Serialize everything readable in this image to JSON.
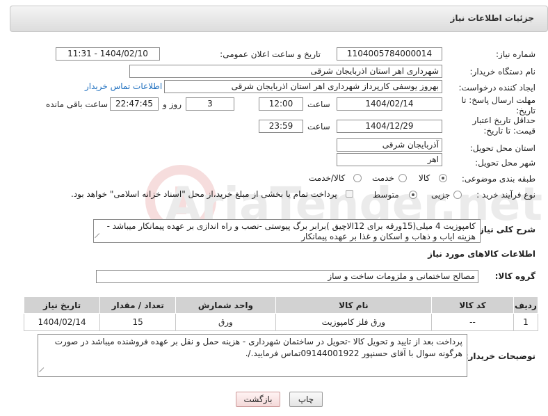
{
  "header": {
    "title": "جزئیات اطلاعات نیاز"
  },
  "labels": {
    "need_number": "شماره نیاز:",
    "announce_datetime": "تاریخ و ساعت اعلان عمومی:",
    "buyer_org": "نام دستگاه خریدار:",
    "requester": "ایجاد کننده درخواست:",
    "reply_deadline": "مهلت ارسال پاسخ: تا تاریخ:",
    "price_validity": "حداقل تاریخ اعتبار قیمت: تا تاریخ:",
    "time": "ساعت",
    "days_and": "روز و",
    "remaining": "ساعت باقی مانده",
    "delivery_province": "استان محل تحویل:",
    "delivery_city": "شهر محل تحویل:",
    "category": "طبقه بندی موضوعی:",
    "purchase_type": "نوع فرآیند خرید :",
    "general_desc": "شرح کلی نیاز:",
    "goods_info_title": "اطلاعات کالاهای مورد نیاز",
    "goods_group": "گروه کالا:",
    "buyer_notes": "توضیحات خریدار:"
  },
  "values": {
    "need_number": "1104005784000014",
    "announce_datetime": "1404/02/10 - 11:31",
    "buyer_org": "شهرداری اهر استان اذربایجان شرقی",
    "requester": "بهروز یوسفی کارپرداز شهرداری اهر استان اذربایجان شرقی",
    "buyer_contact_link": "اطلاعات تماس خریدار",
    "reply_date": "1404/02/14",
    "reply_time": "12:00",
    "reply_days": "3",
    "reply_remaining": "22:47:45",
    "validity_date": "1404/12/29",
    "validity_time": "23:59",
    "delivery_province": "آذربایجان شرقی",
    "delivery_city": "اهر",
    "general_desc": "کامپوزیت 4 میلی(15ورقه برای 12الاچیق )برابر برگ پیوستی -نصب و راه اندازی بر عهده پیمانکار میباشد - هزینه ایاب و ذهاب و اسکان و غذا بر عهده پیمانکار",
    "goods_group": "مصالح ساختمانی و ملزومات ساخت و ساز",
    "buyer_notes": "پرداخت بعد از تایید و تحویل کالا -تحویل در ساختمان شهرداری - هزینه حمل و نقل بر عهده فروشنده میباشد در صورت هرگونه سوال با آقای حسنپور 09144001922تماس فرمایید./."
  },
  "category_options": [
    {
      "label": "کالا",
      "selected": true
    },
    {
      "label": "خدمت",
      "selected": false
    },
    {
      "label": "کالا/خدمت",
      "selected": false
    }
  ],
  "purchase_options": [
    {
      "label": "جزیی",
      "selected": false
    },
    {
      "label": "متوسط",
      "selected": true
    }
  ],
  "purchase_note": "پرداخت تمام یا بخشی از مبلغ خرید،از محل \"اسناد خزانه اسلامی\" خواهد بود.",
  "table": {
    "headers": [
      "ردیف",
      "کد کالا",
      "نام کالا",
      "واحد شمارش",
      "تعداد / مقدار",
      "تاریخ نیاز"
    ],
    "rows": [
      [
        "1",
        "--",
        "ورق فلز کامپوزیت",
        "ورق",
        "15",
        "1404/02/14"
      ]
    ]
  },
  "buttons": {
    "print": "چاپ",
    "back": "بازگشت"
  },
  "watermark_text": "AriaTender.net",
  "colors": {
    "link": "#1e6fbf",
    "header_bg": "#dcdcdc",
    "table_header": "#d2d2d2"
  }
}
